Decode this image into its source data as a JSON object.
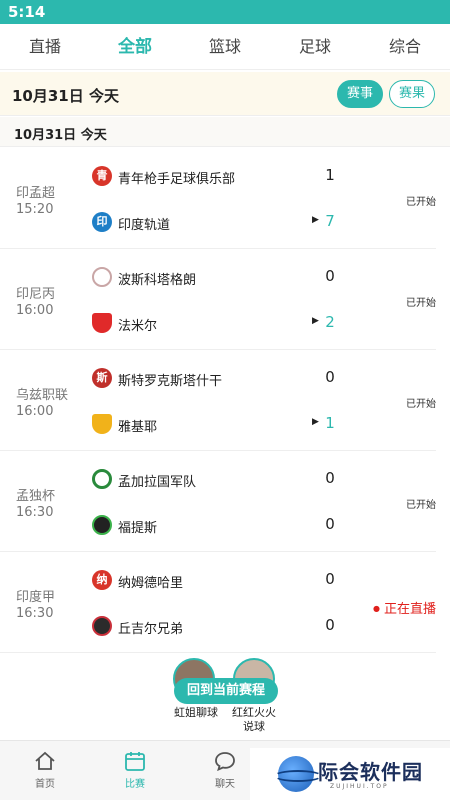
{
  "status_bar": {
    "time": "5:14"
  },
  "tabs": [
    {
      "label": "直播",
      "active": false
    },
    {
      "label": "全部",
      "active": true
    },
    {
      "label": "篮球",
      "active": false
    },
    {
      "label": "足球",
      "active": false
    },
    {
      "label": "综合",
      "active": false
    }
  ],
  "date_header": {
    "date": "10月31日 今天",
    "events_label": "赛事",
    "results_label": "赛果"
  },
  "sub_date": "10月31日 今天",
  "matches": [
    {
      "league": "印孟超",
      "time": "15:20",
      "state": "已开始",
      "home": {
        "name": "青年枪手足球俱乐部",
        "logo": "青",
        "score": "1"
      },
      "away": {
        "name": "印度轨道",
        "logo": "印",
        "score": "7"
      }
    },
    {
      "league": "印尼丙",
      "time": "16:00",
      "state": "已开始",
      "home": {
        "name": "波斯科塔格朗",
        "logo": "",
        "score": "0"
      },
      "away": {
        "name": "法米尔",
        "logo": "",
        "score": "2"
      }
    },
    {
      "league": "乌兹职联",
      "time": "16:00",
      "state": "已开始",
      "home": {
        "name": "斯特罗克斯塔什干",
        "logo": "斯",
        "score": "0"
      },
      "away": {
        "name": "雅基耶",
        "logo": "",
        "score": "1"
      }
    },
    {
      "league": "孟独杯",
      "time": "16:30",
      "state": "已开始",
      "home": {
        "name": "孟加拉国军队",
        "logo": "",
        "score": "0"
      },
      "away": {
        "name": "福提斯",
        "logo": "",
        "score": "0"
      }
    },
    {
      "league": "印度甲",
      "time": "16:30",
      "state": "正在直播",
      "home": {
        "name": "纳姆德哈里",
        "logo": "纳",
        "score": "0"
      },
      "away": {
        "name": "丘吉尔兄弟",
        "logo": "",
        "score": "0"
      }
    }
  ],
  "float": {
    "back_label": "回到当前赛程",
    "anchor1": "虹姐聊球",
    "anchor2": "红红火火说球"
  },
  "bottom_nav": [
    {
      "label": "首页",
      "icon": "home-icon",
      "active": false
    },
    {
      "label": "比赛",
      "icon": "calendar-icon",
      "active": true
    },
    {
      "label": "聊天",
      "icon": "chat-bubble-icon",
      "active": false
    }
  ],
  "watermark": {
    "text": "际会软件园",
    "sub": "ZUJIHUI.TOP"
  },
  "colors": {
    "accent": "#2cb8ae",
    "live": "#e0201c",
    "date_bg": "#fdf9ec"
  }
}
